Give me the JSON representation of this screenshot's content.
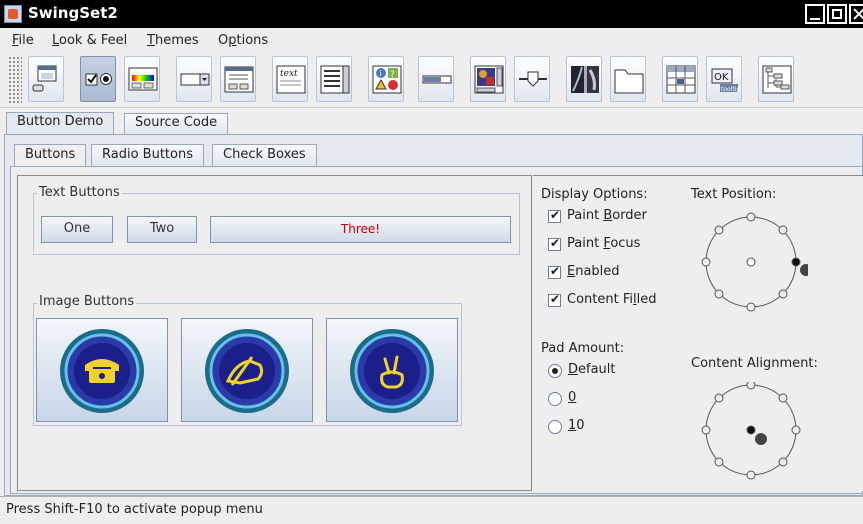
{
  "window": {
    "title": "SwingSet2"
  },
  "menubar": {
    "items": [
      {
        "label": "File",
        "mnemonic": "F",
        "rest": "ile"
      },
      {
        "label": "Look & Feel",
        "mnemonic": "L",
        "rest": "ook & Feel"
      },
      {
        "label": "Themes",
        "mnemonic": "T",
        "rest": "hemes"
      },
      {
        "label": "Options",
        "pre": "O",
        "mnemonic": "p",
        "rest": "tions"
      }
    ]
  },
  "toolbar": {
    "icons": [
      "internal-frame-icon",
      "button-demo-icon",
      "color-chooser-icon",
      "combobox-icon",
      "file-chooser-icon",
      "html-text-icon",
      "list-icon",
      "option-pane-icon",
      "progress-bar-icon",
      "scroll-pane-icon",
      "slider-icon",
      "split-pane-icon",
      "tabbed-pane-icon",
      "table-icon",
      "tooltip-icon",
      "tree-icon"
    ],
    "selected": "button-demo-icon",
    "tooltip_text": {
      "ok": "OK",
      "tip": "tooltip"
    },
    "html_text": "text"
  },
  "outer_tabs": [
    "Button Demo",
    "Source Code"
  ],
  "inner_tabs": [
    "Buttons",
    "Radio Buttons",
    "Check Boxes"
  ],
  "text_buttons": {
    "title": "Text Buttons",
    "buttons": [
      "One",
      "Two",
      "Three!"
    ]
  },
  "image_buttons": {
    "title": "Image Buttons"
  },
  "display_options": {
    "title": "Display Options:",
    "items": [
      {
        "pre": "Paint ",
        "mnemonic": "B",
        "rest": "order",
        "checked": true
      },
      {
        "pre": "Paint ",
        "mnemonic": "F",
        "rest": "ocus",
        "checked": true
      },
      {
        "pre": "",
        "mnemonic": "E",
        "rest": "nabled",
        "checked": true
      },
      {
        "pre": "Content Fi",
        "mnemonic": "l",
        "rest": "led",
        "checked": true
      }
    ]
  },
  "pad_amount": {
    "title": "Pad Amount:",
    "options": [
      {
        "mnemonic": "D",
        "rest": "efault",
        "selected": true
      },
      {
        "mnemonic": "0",
        "rest": "",
        "selected": false
      },
      {
        "mnemonic": "1",
        "rest": "0",
        "selected": false
      }
    ]
  },
  "text_position": {
    "title": "Text Position:",
    "selected": "right"
  },
  "content_alignment": {
    "title": "Content Alignment:",
    "selected": "center"
  },
  "status": {
    "text": "Press Shift-F10 to activate popup menu"
  }
}
